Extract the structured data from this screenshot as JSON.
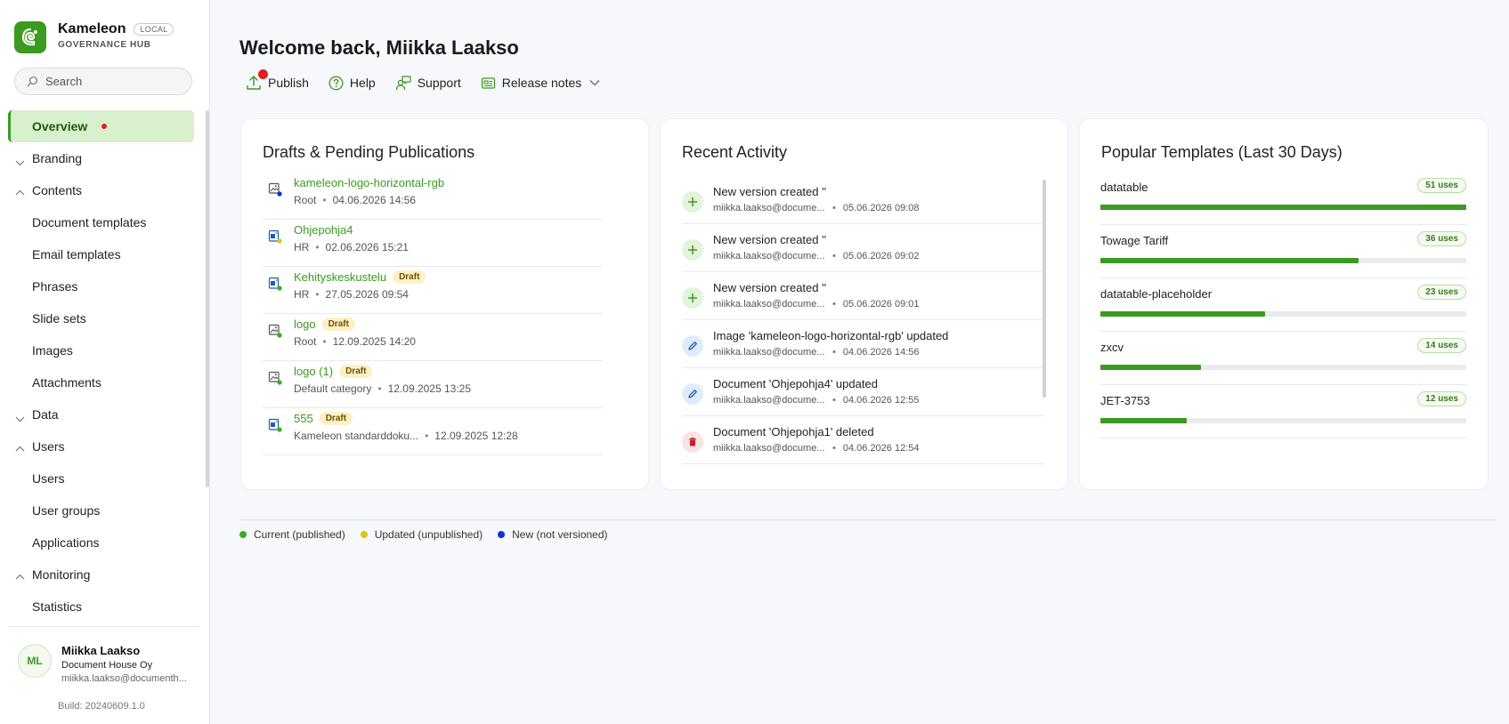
{
  "brand": {
    "name": "Kameleon",
    "badge": "LOCAL",
    "subtitle": "GOVERNANCE HUB",
    "color": "#3b9a1f"
  },
  "search": {
    "placeholder": "Search"
  },
  "nav": [
    {
      "label": "Overview",
      "active": true,
      "dot": true
    },
    {
      "label": "Branding",
      "chevron": "down"
    },
    {
      "label": "Contents",
      "chevron": "up"
    },
    {
      "label": "Document templates"
    },
    {
      "label": "Email templates"
    },
    {
      "label": "Phrases"
    },
    {
      "label": "Slide sets"
    },
    {
      "label": "Images"
    },
    {
      "label": "Attachments"
    },
    {
      "label": "Data",
      "chevron": "down"
    },
    {
      "label": "Users",
      "chevron": "up"
    },
    {
      "label": "Users"
    },
    {
      "label": "User groups"
    },
    {
      "label": "Applications"
    },
    {
      "label": "Monitoring",
      "chevron": "up"
    },
    {
      "label": "Statistics"
    }
  ],
  "user": {
    "initials": "ML",
    "name": "Miikka Laakso",
    "company": "Document House Oy",
    "email": "miikka.laakso@documenth..."
  },
  "build": "Build: 20240609.1.0",
  "header": {
    "title": "Welcome back, Miikka Laakso",
    "toolbar": {
      "publish": "Publish",
      "help": "Help",
      "support": "Support",
      "release_notes": "Release notes"
    }
  },
  "drafts": {
    "title": "Drafts & Pending Publications",
    "items": [
      {
        "name": "kameleon-logo-horizontal-rgb",
        "badge": "",
        "category": "Root",
        "date": "04.06.2026 14:56",
        "status": "new",
        "icon": "image-file-icon"
      },
      {
        "name": "Ohjepohja4",
        "badge": "",
        "category": "HR",
        "date": "02.06.2026 15:21",
        "status": "updated",
        "icon": "document-file-icon"
      },
      {
        "name": "Kehityskeskustelu",
        "badge": "Draft",
        "category": "HR",
        "date": "27.05.2026 09:54",
        "status": "current",
        "icon": "document-file-icon"
      },
      {
        "name": "logo",
        "badge": "Draft",
        "category": "Root",
        "date": "12.09.2025 14:20",
        "status": "current",
        "icon": "image-file-icon"
      },
      {
        "name": "logo (1)",
        "badge": "Draft",
        "category": "Default category",
        "date": "12.09.2025 13:25",
        "status": "current",
        "icon": "image-file-icon"
      },
      {
        "name": "555",
        "badge": "Draft",
        "category": "Kameleon standarddoku...",
        "date": "12.09.2025 12:28",
        "status": "current",
        "icon": "document-file-icon"
      }
    ]
  },
  "activity": {
    "title": "Recent Activity",
    "items": [
      {
        "type": "created",
        "title": "New version created ''",
        "user": "miikka.laakso@docume...",
        "date": "05.06.2026 09:08"
      },
      {
        "type": "created",
        "title": "New version created ''",
        "user": "miikka.laakso@docume...",
        "date": "05.06.2026 09:02"
      },
      {
        "type": "created",
        "title": "New version created ''",
        "user": "miikka.laakso@docume...",
        "date": "05.06.2026 09:01"
      },
      {
        "type": "updated",
        "title": "Image 'kameleon-logo-horizontal-rgb' updated",
        "user": "miikka.laakso@docume...",
        "date": "04.06.2026 14:56"
      },
      {
        "type": "updated",
        "title": "Document 'Ohjepohja4' updated",
        "user": "miikka.laakso@docume...",
        "date": "04.06.2026 12:55"
      },
      {
        "type": "deleted",
        "title": "Document 'Ohjepohja1' deleted",
        "user": "miikka.laakso@docume...",
        "date": "04.06.2026 12:54"
      }
    ]
  },
  "templates": {
    "title": "Popular Templates (Last 30 Days)",
    "items": [
      {
        "name": "datatable",
        "uses": "51 uses",
        "count": 51
      },
      {
        "name": "Towage Tariff",
        "uses": "36 uses",
        "count": 36
      },
      {
        "name": "datatable-placeholder",
        "uses": "23 uses",
        "count": 23
      },
      {
        "name": "zxcv",
        "uses": "14 uses",
        "count": 14
      },
      {
        "name": "JET-3753",
        "uses": "12 uses",
        "count": 12
      }
    ]
  },
  "legend": {
    "current": "Current (published)",
    "updated": "Updated (unpublished)",
    "new": "New (not versioned)"
  },
  "colors": {
    "accent": "#3b9a1f",
    "current": "#3bab1f",
    "updated": "#d9c51a",
    "new": "#1230d6",
    "notification": "#e01f1f",
    "deleted": "#c8202a"
  }
}
